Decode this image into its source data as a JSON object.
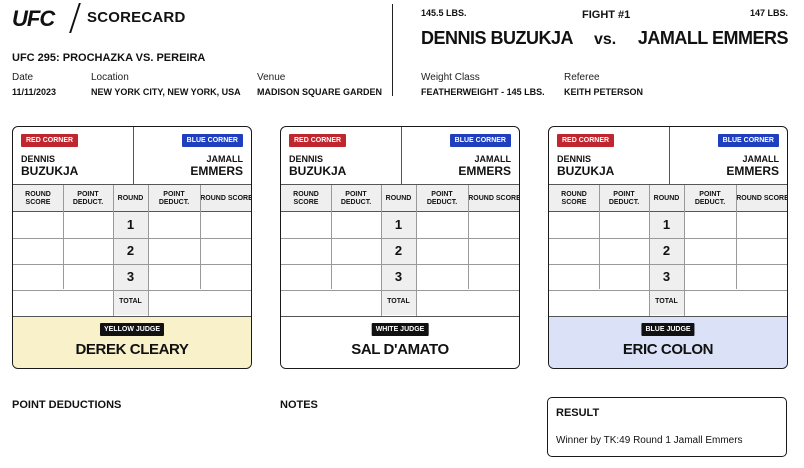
{
  "header": {
    "logo": "UFC",
    "scorecard_label": "SCORECARD",
    "event": "UFC 295: PROCHAZKA VS. PEREIRA",
    "date_label": "Date",
    "date": "11/11/2023",
    "location_label": "Location",
    "location": "NEW YORK CITY, NEW YORK, USA",
    "venue_label": "Venue",
    "venue": "MADISON SQUARE GARDEN"
  },
  "fight": {
    "number": "FIGHT #1",
    "red_weight": "145.5 LBS.",
    "blue_weight": "147 LBS.",
    "red_name": "DENNIS BUZUKJA",
    "blue_name": "JAMALL EMMERS",
    "vs": "vs.",
    "weight_class_label": "Weight Class",
    "weight_class": "FEATHERWEIGHT - 145 LBS.",
    "referee_label": "Referee",
    "referee": "KEITH PETERSON"
  },
  "card_labels": {
    "red_corner": "RED CORNER",
    "blue_corner": "BLUE CORNER",
    "red_first": "DENNIS",
    "red_last": "BUZUKJA",
    "blue_first": "JAMALL",
    "blue_last": "EMMERS",
    "round_score": "ROUND SCORE",
    "point_deduct": "POINT DEDUCT.",
    "round": "ROUND",
    "rounds": [
      "1",
      "2",
      "3"
    ],
    "total": "TOTAL"
  },
  "judges": [
    {
      "badge": "YELLOW JUDGE",
      "name": "DEREK CLEARY",
      "color": "#f8f1c9"
    },
    {
      "badge": "WHITE JUDGE",
      "name": "SAL D'AMATO",
      "color": "#ffffff"
    },
    {
      "badge": "BLUE JUDGE",
      "name": "ERIC COLON",
      "color": "#dbe2f7"
    }
  ],
  "footer": {
    "point_deductions": "POINT DEDUCTIONS",
    "notes": "NOTES",
    "result_title": "RESULT",
    "result_text": "Winner by TK:49 Round 1 Jamall Emmers"
  }
}
